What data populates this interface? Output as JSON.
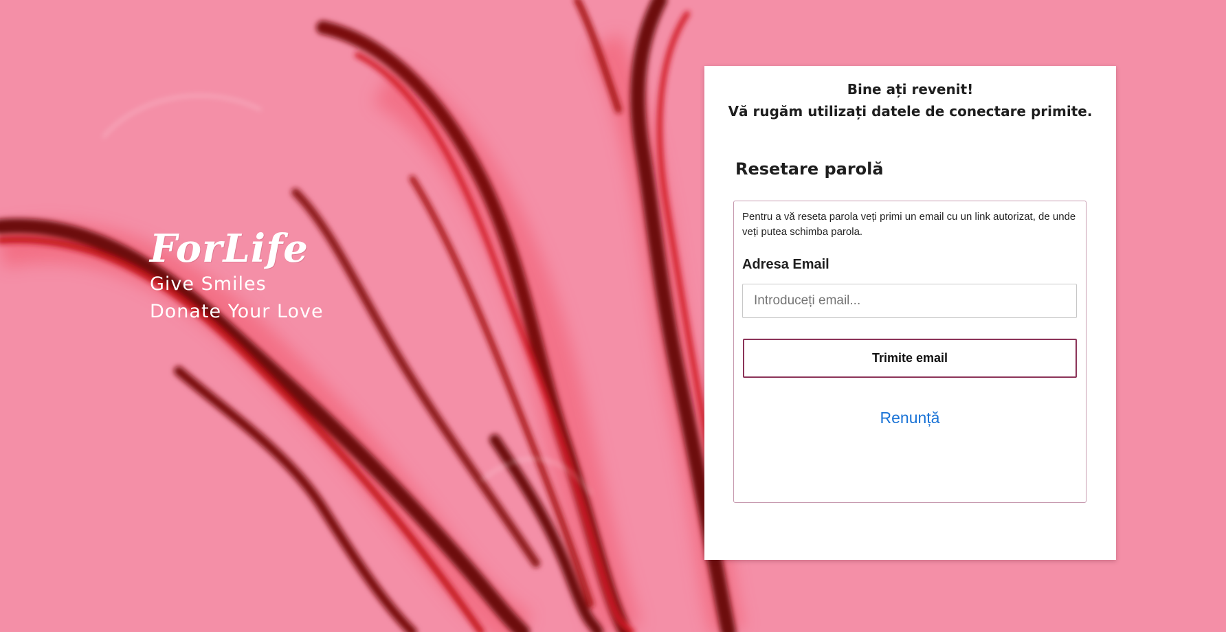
{
  "brand": {
    "logo": "ForLife",
    "tagline_1": "Give Smiles",
    "tagline_2": "Donate Your Love"
  },
  "card": {
    "welcome_line_1": "Bine ați revenit!",
    "welcome_line_2": "Vă rugăm utilizați datele de conectare primite.",
    "section_title": "Resetare parolă",
    "info_text": "Pentru a vă reseta parola veți primi un email cu un link autorizat, de unde veți putea schimba parola.",
    "email_label": "Adresa Email",
    "email_placeholder": "Introduceți email...",
    "email_value": "",
    "send_button": "Trimite email",
    "cancel_link": "Renunță"
  },
  "colors": {
    "background": "#f48fa7",
    "smoke_dark": "#7a1010",
    "smoke_red": "#e8283a",
    "button_border": "#8b3358",
    "link": "#1a73d6"
  }
}
